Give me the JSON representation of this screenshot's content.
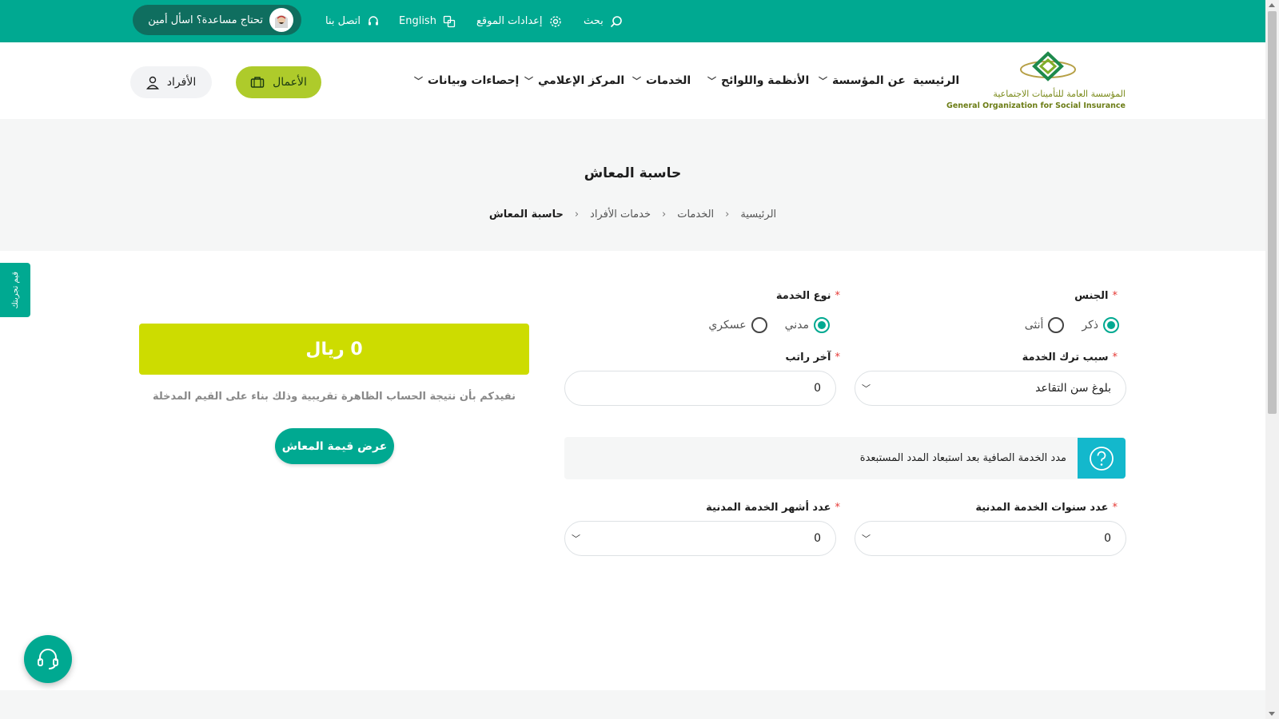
{
  "topbar": {
    "search_label": "بحث",
    "settings_label": "إعدادات الموقع",
    "language_label": "English",
    "contact_label": "اتصل بنا",
    "help_label": "تحتاج مساعدة؟ اسأل أمين"
  },
  "header": {
    "logo_ar": "المؤسسة العامة للتأمينات الاجتماعية",
    "logo_en": "General Organization for Social Insurance",
    "nav": [
      "الرئيسية",
      "عن المؤسسة",
      "الأنظمة واللوائح",
      "الخدمات",
      "المركز الإعلامي",
      "إحصاءات وبيانات"
    ],
    "business_label": "الأعمال",
    "individuals_label": "الأفراد"
  },
  "hero": {
    "title": "حاسبة المعاش",
    "breadcrumb": [
      "الرئيسية",
      "الخدمات",
      "خدمات الأفراد",
      "حاسبة المعاش"
    ]
  },
  "feedback_tab": "قيم تجربتك",
  "form": {
    "gender_label": "الجنس",
    "gender_options": [
      "ذكر",
      "أنثى"
    ],
    "gender_selected": "ذكر",
    "service_type_label": "نوع الخدمة",
    "service_type_options": [
      "مدني",
      "عسكري"
    ],
    "service_type_selected": "مدني",
    "leave_reason_label": "سبب ترك الخدمة",
    "leave_reason_value": "بلوغ سن التقاعد",
    "last_salary_label": "آخر راتب",
    "last_salary_value": "0",
    "info_text": "مدد الخدمة الصافية بعد استبعاد المدد المستبعدة",
    "years_label": "عدد سنوات الخدمة المدنية",
    "years_value": "0",
    "months_label": "عدد أشهر الخدمة المدنية",
    "months_value": "0"
  },
  "result": {
    "value_text": "0 ريال",
    "note": "نفيدكم بأن نتيجة الحساب الظاهرة تقريبية وذلك بناء على القيم المدخلة",
    "button_label": "عرض قيمة المعاش"
  },
  "colors": {
    "primary": "#00a991",
    "accent_green": "#aecb2b",
    "result_yellow": "#cddc00",
    "info_cyan": "#13b8cc"
  }
}
